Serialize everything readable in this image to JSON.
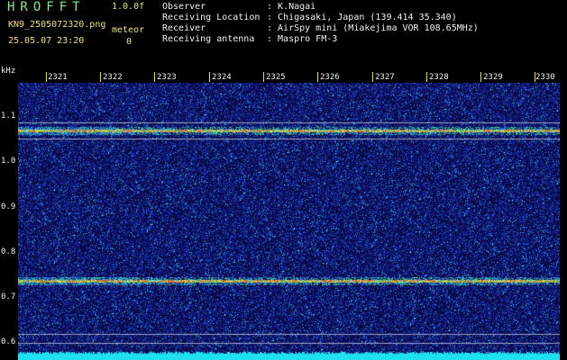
{
  "header": {
    "app_title": "HROFFT",
    "fps": "1.0.0f",
    "filename": "KN9_2505072320.png",
    "meteor_label": "meteor",
    "timestamp": "25.05.07 23:20",
    "meteor_count": "0",
    "info": [
      {
        "key": "Observer",
        "value": ": K.Nagai"
      },
      {
        "key": "Receiving Location",
        "value": ": Chigasaki, Japan (139.414 35.340)"
      },
      {
        "key": "Receiver",
        "value": ": AirSpy mini (Miakejima VOR 108.65MHz)"
      },
      {
        "key": "Receiving antenna",
        "value": ": Maspro FM-3"
      }
    ]
  },
  "axis": {
    "unit": "kHz",
    "y_ticks": [
      "1.1",
      "1.0",
      "0.9",
      "0.8",
      "0.7",
      "0.6"
    ],
    "x_ticks": [
      "2321",
      "2322",
      "2323",
      "2324",
      "2325",
      "2326",
      "2327",
      "2328",
      "2329",
      "2330"
    ]
  },
  "colors": {
    "background": "#000000",
    "plot_bg": "#06063a",
    "marker": "#e8e800",
    "title": "#7cf07c",
    "header_text": "#f0e27a"
  }
}
